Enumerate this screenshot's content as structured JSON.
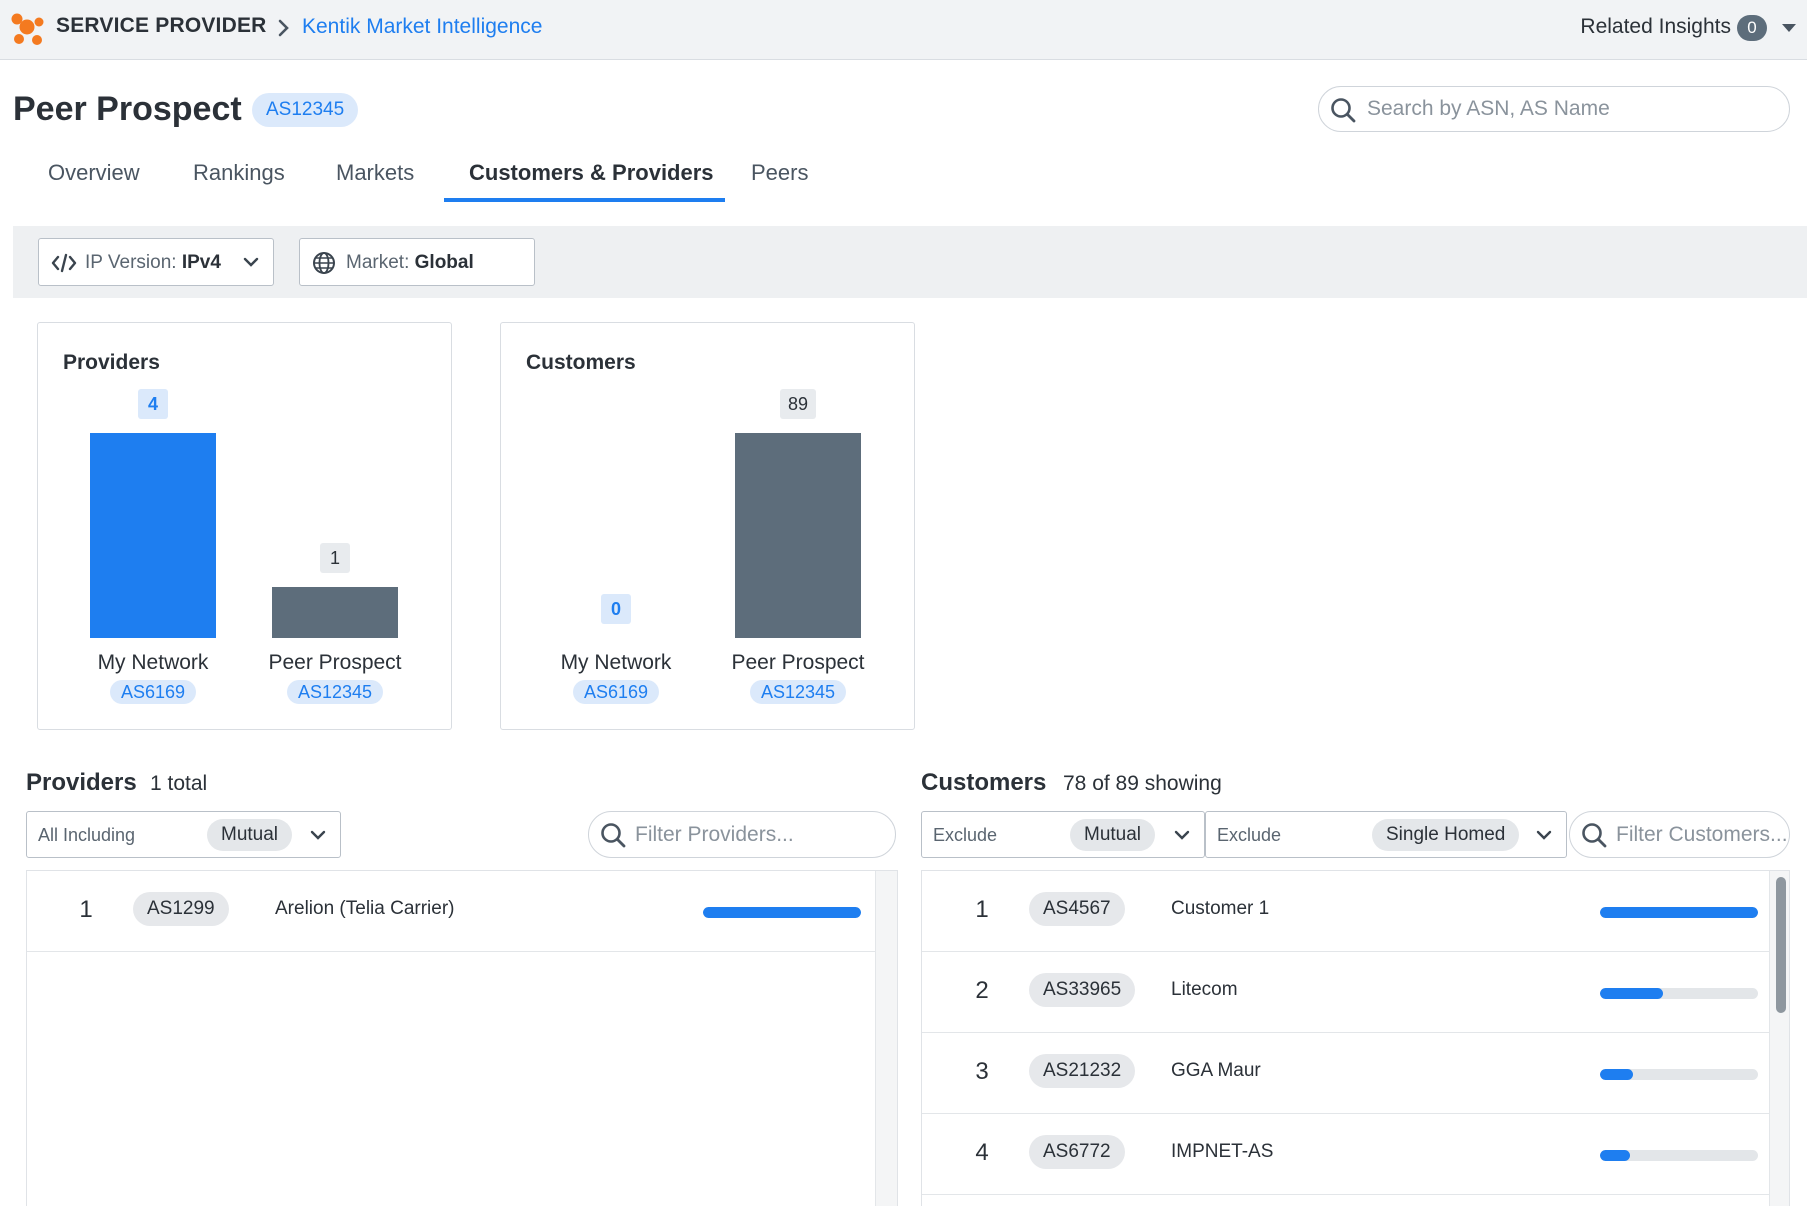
{
  "topbar": {
    "section": "SERVICE PROVIDER",
    "app_link": "Kentik Market Intelligence",
    "related_label": "Related Insights",
    "related_count": "0"
  },
  "header": {
    "title": "Peer Prospect",
    "asn": "AS12345",
    "search_placeholder": "Search by ASN, AS Name"
  },
  "tabs": [
    {
      "label": "Overview",
      "active": false
    },
    {
      "label": "Rankings",
      "active": false
    },
    {
      "label": "Markets",
      "active": false
    },
    {
      "label": "Customers & Providers",
      "active": true
    },
    {
      "label": "Peers",
      "active": false
    }
  ],
  "filters": {
    "ip_version_label": "IP Version:",
    "ip_version_value": "IPv4",
    "market_label": "Market:",
    "market_value": "Global"
  },
  "colors": {
    "accent": "#1e7ef0",
    "bar_gray": "#5d6d7b"
  },
  "chart_data": [
    {
      "type": "bar",
      "title": "Providers",
      "categories": [
        "My Network",
        "Peer Prospect"
      ],
      "category_asns": [
        "AS6169",
        "AS12345"
      ],
      "values": [
        4,
        1
      ],
      "value_labels": [
        "4",
        "1"
      ],
      "colors": [
        "#1e7ef0",
        "#5d6d7b"
      ]
    },
    {
      "type": "bar",
      "title": "Customers",
      "categories": [
        "My Network",
        "Peer Prospect"
      ],
      "category_asns": [
        "AS6169",
        "AS12345"
      ],
      "values": [
        0,
        89
      ],
      "value_labels": [
        "0",
        "89"
      ],
      "colors": [
        "#1e7ef0",
        "#5d6d7b"
      ]
    }
  ],
  "providers": {
    "title": "Providers",
    "subtitle": "1 total",
    "select_prefix": "All Including",
    "select_value": "Mutual",
    "filter_placeholder": "Filter Providers...",
    "rows": [
      {
        "rank": "1",
        "asn": "AS1299",
        "name": "Arelion (Telia Carrier)",
        "fill": 1.0
      }
    ]
  },
  "customers": {
    "title": "Customers",
    "subtitle": "78 of 89 showing",
    "select1_prefix": "Exclude",
    "select1_value": "Mutual",
    "select2_prefix": "Exclude",
    "select2_value": "Single Homed",
    "filter_placeholder": "Filter Customers...",
    "rows": [
      {
        "rank": "1",
        "asn": "AS4567",
        "name": "Customer 1",
        "fill": 1.0
      },
      {
        "rank": "2",
        "asn": "AS33965",
        "name": "Litecom",
        "fill": 0.4
      },
      {
        "rank": "3",
        "asn": "AS21232",
        "name": "GGA Maur",
        "fill": 0.21
      },
      {
        "rank": "4",
        "asn": "AS6772",
        "name": "IMPNET-AS",
        "fill": 0.19
      }
    ]
  }
}
